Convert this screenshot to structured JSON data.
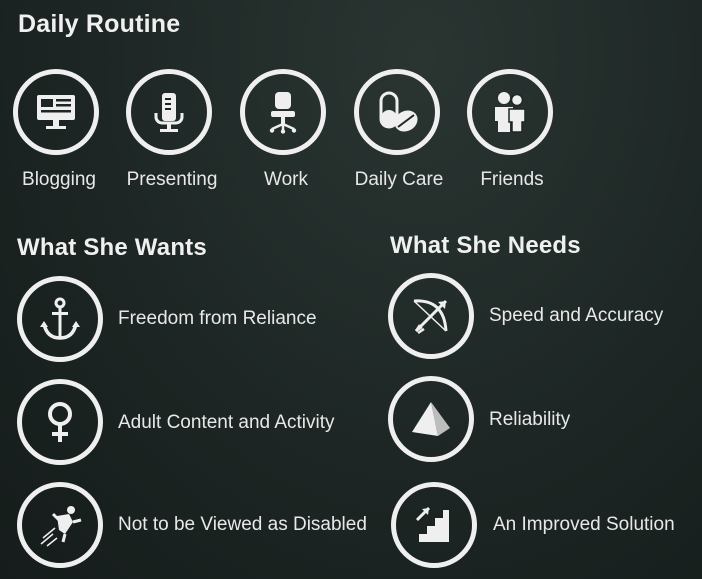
{
  "daily_routine": {
    "title": "Daily Routine",
    "items": [
      {
        "label": "Blogging",
        "icon": "computer-monitor-icon"
      },
      {
        "label": "Presenting",
        "icon": "podium-icon"
      },
      {
        "label": "Work",
        "icon": "office-chair-icon"
      },
      {
        "label": "Daily Care",
        "icon": "pills-icon"
      },
      {
        "label": "Friends",
        "icon": "people-icon"
      }
    ]
  },
  "wants": {
    "title": "What She Wants",
    "items": [
      {
        "label": "Freedom from Reliance",
        "icon": "anchor-icon"
      },
      {
        "label": "Adult Content and Activity",
        "icon": "female-symbol-icon"
      },
      {
        "label": "Not to be Viewed as Disabled",
        "icon": "running-person-icon"
      }
    ]
  },
  "needs": {
    "title": "What She Needs",
    "items": [
      {
        "label": "Speed and Accuracy",
        "icon": "bow-and-arrow-icon"
      },
      {
        "label": "Reliability",
        "icon": "pyramid-icon"
      },
      {
        "label": "An Improved Solution",
        "icon": "stairs-up-icon"
      }
    ]
  },
  "colors": {
    "background": "#1d2624",
    "foreground": "#efefef"
  }
}
